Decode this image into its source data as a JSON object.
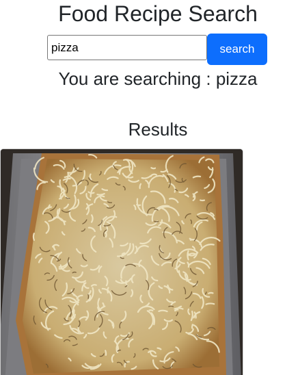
{
  "header": {
    "title": "Food Recipe Search"
  },
  "search": {
    "value": "pizza",
    "placeholder": "",
    "button_label": "search"
  },
  "status": {
    "prefix": "You are searching :",
    "query": "pizza"
  },
  "results": {
    "heading": "Results",
    "items": [
      {
        "image_subject": "pizza-photo"
      }
    ]
  },
  "colors": {
    "accent": "#0d6efd",
    "text": "#212529",
    "background": "#ffffff"
  }
}
